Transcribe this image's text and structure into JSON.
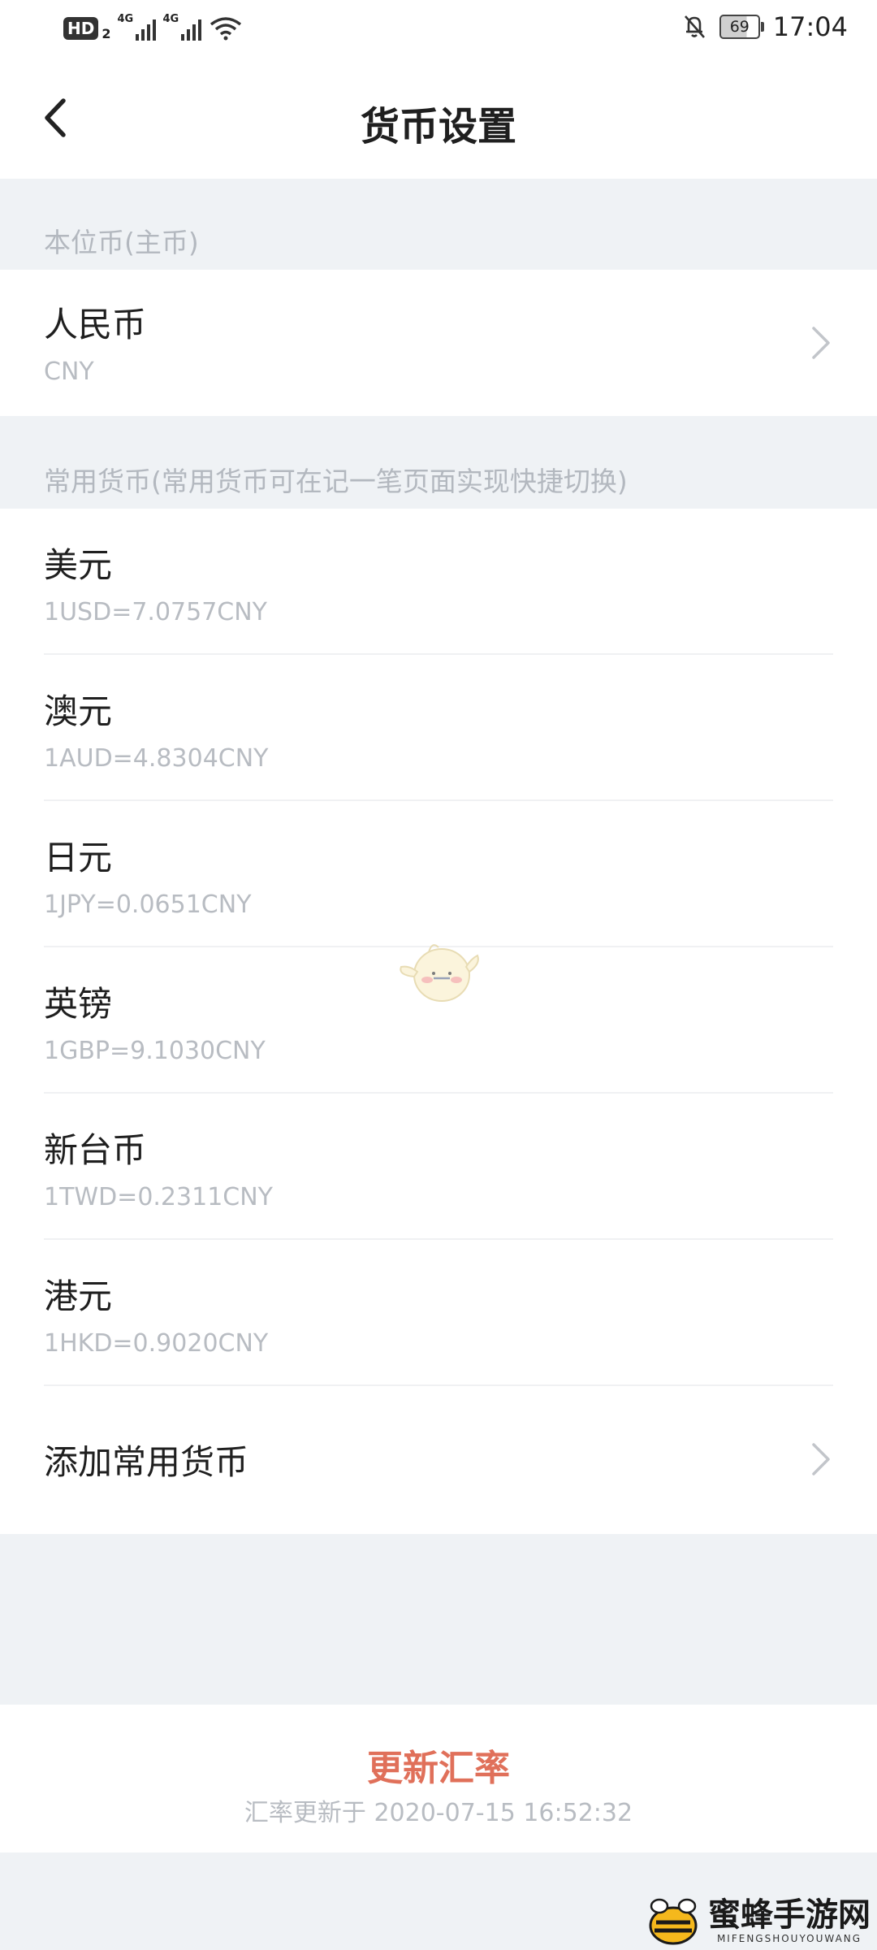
{
  "status_bar": {
    "hd_label": "HD",
    "hd_sub": "2",
    "signal1_label": "4G",
    "signal2_label": "4G",
    "battery": "69",
    "battery_level": 0.69,
    "time": "17:04"
  },
  "header": {
    "title": "货币设置"
  },
  "base_currency": {
    "section_label": "本位币(主币)",
    "name": "人民币",
    "code": "CNY"
  },
  "common_currencies": {
    "section_label": "常用货币(常用货币可在记一笔页面实现快捷切换)",
    "items": [
      {
        "name": "美元",
        "rate": "1USD=7.0757CNY"
      },
      {
        "name": "澳元",
        "rate": "1AUD=4.8304CNY"
      },
      {
        "name": "日元",
        "rate": "1JPY=0.0651CNY"
      },
      {
        "name": "英镑",
        "rate": "1GBP=9.1030CNY"
      },
      {
        "name": "新台币",
        "rate": "1TWD=0.2311CNY"
      },
      {
        "name": "港元",
        "rate": "1HKD=0.9020CNY"
      }
    ],
    "add_label": "添加常用货币"
  },
  "footer": {
    "update_label": "更新汇率",
    "update_time": "汇率更新于 2020-07-15 16:52:32"
  },
  "watermark": {
    "cn": "蜜蜂手游网",
    "en": "MIFENGSHOUYOUWANG"
  },
  "colors": {
    "accent": "#e0705a",
    "background": "#eff2f5",
    "muted_text": "#b8bcc2"
  }
}
